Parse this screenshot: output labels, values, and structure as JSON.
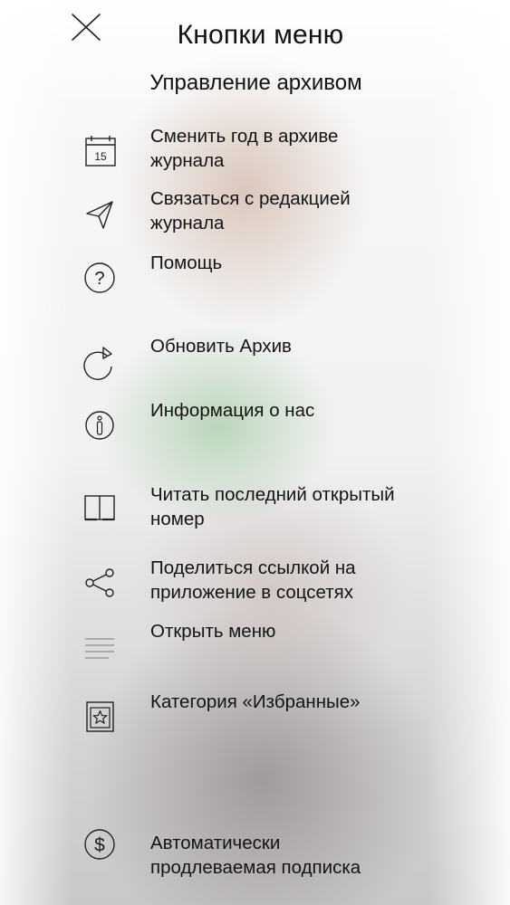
{
  "header": {
    "title": "Кнопки меню",
    "subtitle": "Управление архивом"
  },
  "menu": {
    "items": [
      {
        "icon": "calendar-icon",
        "label_line1": "Сменить год в архиве",
        "label_line2": "журнала",
        "calendar_day": "15"
      },
      {
        "icon": "send-icon",
        "label_line1": "Связаться с редакцией",
        "label_line2": "журнала"
      },
      {
        "icon": "help-icon",
        "label_line1": "Помощь",
        "icon_glyph": "?"
      },
      {
        "icon": "refresh-icon",
        "label_line1": "Обновить Архив"
      },
      {
        "icon": "info-icon",
        "label_line1": "Информация о нас",
        "icon_glyph": "i"
      },
      {
        "icon": "book-icon",
        "label_line1": "Читать последний открытый",
        "label_line2": "номер"
      },
      {
        "icon": "share-icon",
        "label_line1": "Поделиться ссылкой на",
        "label_line2": "приложение в соцсетях"
      },
      {
        "icon": "menu-lines-icon",
        "label_line1": "Открыть меню"
      },
      {
        "icon": "favorites-star-icon",
        "label_line1": "Категория «Избранные»"
      },
      {
        "icon": "dollar-icon",
        "label_line1": "Автоматически",
        "label_line2": "продлеваемая подписка",
        "icon_glyph": "$"
      }
    ]
  },
  "colors": {
    "text": "#111111",
    "icon_stroke": "#222222",
    "menu_lines_icon": "#8a8a8a"
  }
}
